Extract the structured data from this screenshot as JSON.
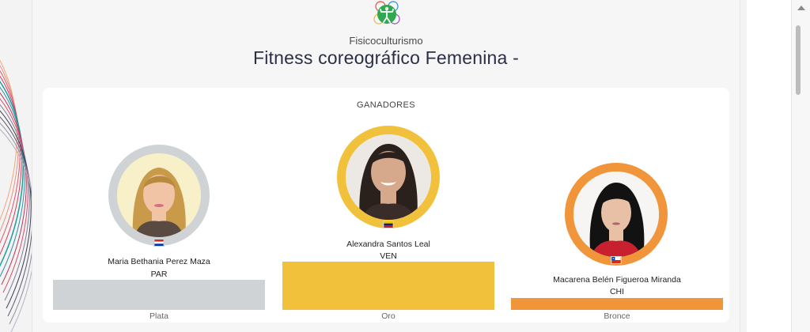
{
  "sport": {
    "label": "Fisicoculturismo",
    "icon": "bodybuilding-sport-icon"
  },
  "event": {
    "title": "Fitness coreográfico Femenina -"
  },
  "winners": {
    "heading": "GANADORES",
    "podium": [
      {
        "name": "Maria Bethania Perez Maza",
        "country": "PAR",
        "place": "Plata",
        "flag": "paraguay-flag-icon",
        "color": "#d0d3d6"
      },
      {
        "name": "Alexandra Santos Leal",
        "country": "VEN",
        "place": "Oro",
        "flag": "venezuela-flag-icon",
        "color": "#f1c13c"
      },
      {
        "name": "Macarena Belén Figueroa Miranda",
        "country": "CHI",
        "place": "Bronce",
        "flag": "chile-flag-icon",
        "color": "#f0953a"
      }
    ]
  },
  "browser": {
    "search_icon": "search-icon"
  }
}
